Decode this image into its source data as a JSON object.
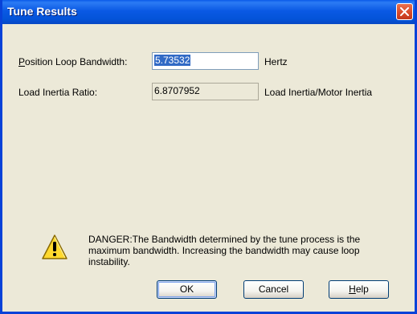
{
  "window": {
    "title": "Tune Results"
  },
  "fields": {
    "bandwidth": {
      "label_mnemonic": "P",
      "label_rest": "osition Loop Bandwidth:",
      "value": "5.73532",
      "unit": "Hertz"
    },
    "inertia": {
      "label": "Load Inertia Ratio:",
      "value": "6.8707952",
      "unit": "Load Inertia/Motor Inertia"
    }
  },
  "warning": {
    "icon": "warning-icon",
    "text": "DANGER:The Bandwidth determined by the tune process is the maximum bandwidth. Increasing the bandwidth may cause loop instability."
  },
  "buttons": {
    "ok": "OK",
    "cancel": "Cancel",
    "help_mnemonic": "H",
    "help_rest": "elp"
  },
  "colors": {
    "titlebar": "#0A59E4",
    "dialog_bg": "#ECE9D8",
    "selection": "#316AC5",
    "close_button": "#D94A2A"
  }
}
